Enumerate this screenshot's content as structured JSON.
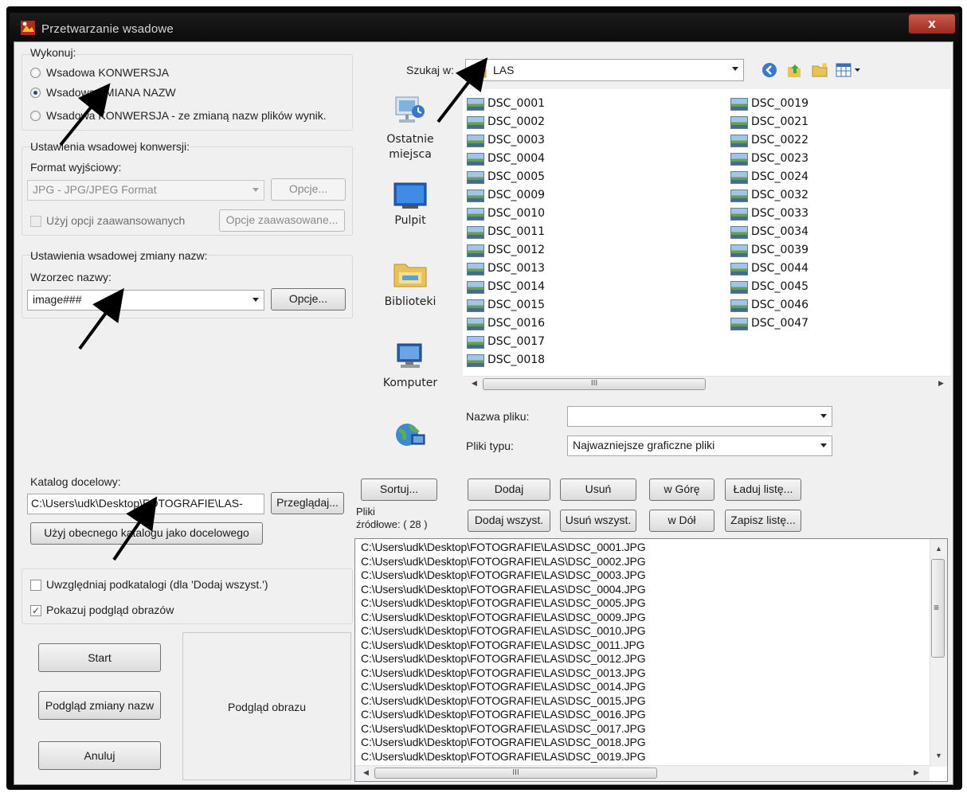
{
  "window": {
    "title": "Przetwarzanie wsadowe",
    "close_label": "x"
  },
  "execute": {
    "label": "Wykonuj:",
    "options": [
      {
        "label": "Wsadowa  KONWERSJA",
        "selected": false
      },
      {
        "label": "Wsadowa  ZMIANA NAZW",
        "selected": true
      },
      {
        "label": "Wsadowa  KONWERSJA - ze zmianą nazw plików wynik.",
        "selected": false
      }
    ]
  },
  "conversion": {
    "label": "Ustawienia wsadowej konwersji:",
    "format_label": "Format wyjściowy:",
    "format_value": "JPG - JPG/JPEG Format",
    "options_button": "Opcje...",
    "advanced_checkbox": "Użyj opcji zaawansowanych",
    "advanced_button": "Opcje zaawasowane..."
  },
  "rename": {
    "label": "Ustawienia wsadowej zmiany nazw:",
    "pattern_label": "Wzorzec nazwy:",
    "pattern_value": "image###",
    "options_button": "Opcje..."
  },
  "target": {
    "label": "Katalog docelowy:",
    "path": "C:\\Users\\udk\\Desktop\\FOTOGRAFIE\\LAS-",
    "browse_button": "Przeglądaj...",
    "use_current_button": "Użyj obecnego katalogu jako docelowego"
  },
  "options": {
    "subfolders": {
      "label": "Uwzględniaj podkatalogi  (dla 'Dodaj wszyst.')",
      "checked": false
    },
    "preview": {
      "label": "Pokazuj podgląd obrazów",
      "checked": true
    }
  },
  "actions": {
    "start": "Start",
    "rename_preview": "Podgląd zmiany nazw",
    "cancel": "Anuluj"
  },
  "preview_pane": {
    "label": "Podgląd obrazu"
  },
  "browser": {
    "look_in_label": "Szukaj w:",
    "look_in_value": "LAS",
    "places": [
      "Ostatnie miejsca",
      "Pulpit",
      "Biblioteki",
      "Komputer"
    ],
    "files_col1": [
      "DSC_0001",
      "DSC_0002",
      "DSC_0003",
      "DSC_0004",
      "DSC_0005",
      "DSC_0009",
      "DSC_0010",
      "DSC_0011",
      "DSC_0012",
      "DSC_0013",
      "DSC_0014",
      "DSC_0015",
      "DSC_0016",
      "DSC_0017",
      "DSC_0018"
    ],
    "files_col2": [
      "DSC_0019",
      "DSC_0021",
      "DSC_0022",
      "DSC_0023",
      "DSC_0024",
      "DSC_0032",
      "DSC_0033",
      "DSC_0034",
      "DSC_0039",
      "DSC_0044",
      "DSC_0045",
      "DSC_0046",
      "DSC_0047"
    ],
    "scroll_grip": "III",
    "filename_label": "Nazwa pliku:",
    "filename_value": "",
    "filetype_label": "Pliki typu:",
    "filetype_value": "Najwazniejsze graficzne pliki"
  },
  "list_buttons": {
    "sort": "Sortuj...",
    "add": "Dodaj",
    "remove": "Usuń",
    "up": "w Górę",
    "load": "Ładuj listę...",
    "add_all": "Dodaj wszyst.",
    "remove_all": "Usuń wszyst.",
    "down": "w Dół",
    "save": "Zapisz listę..."
  },
  "source": {
    "label_line1": "Pliki",
    "label_line2": "źródłowe: ( 28 )",
    "files": [
      "C:\\Users\\udk\\Desktop\\FOTOGRAFIE\\LAS\\DSC_0001.JPG",
      "C:\\Users\\udk\\Desktop\\FOTOGRAFIE\\LAS\\DSC_0002.JPG",
      "C:\\Users\\udk\\Desktop\\FOTOGRAFIE\\LAS\\DSC_0003.JPG",
      "C:\\Users\\udk\\Desktop\\FOTOGRAFIE\\LAS\\DSC_0004.JPG",
      "C:\\Users\\udk\\Desktop\\FOTOGRAFIE\\LAS\\DSC_0005.JPG",
      "C:\\Users\\udk\\Desktop\\FOTOGRAFIE\\LAS\\DSC_0009.JPG",
      "C:\\Users\\udk\\Desktop\\FOTOGRAFIE\\LAS\\DSC_0010.JPG",
      "C:\\Users\\udk\\Desktop\\FOTOGRAFIE\\LAS\\DSC_0011.JPG",
      "C:\\Users\\udk\\Desktop\\FOTOGRAFIE\\LAS\\DSC_0012.JPG",
      "C:\\Users\\udk\\Desktop\\FOTOGRAFIE\\LAS\\DSC_0013.JPG",
      "C:\\Users\\udk\\Desktop\\FOTOGRAFIE\\LAS\\DSC_0014.JPG",
      "C:\\Users\\udk\\Desktop\\FOTOGRAFIE\\LAS\\DSC_0015.JPG",
      "C:\\Users\\udk\\Desktop\\FOTOGRAFIE\\LAS\\DSC_0016.JPG",
      "C:\\Users\\udk\\Desktop\\FOTOGRAFIE\\LAS\\DSC_0017.JPG",
      "C:\\Users\\udk\\Desktop\\FOTOGRAFIE\\LAS\\DSC_0018.JPG",
      "C:\\Users\\udk\\Desktop\\FOTOGRAFIE\\LAS\\DSC_0019.JPG"
    ],
    "scroll_grip": "III",
    "vscroll_grip": "≡"
  }
}
